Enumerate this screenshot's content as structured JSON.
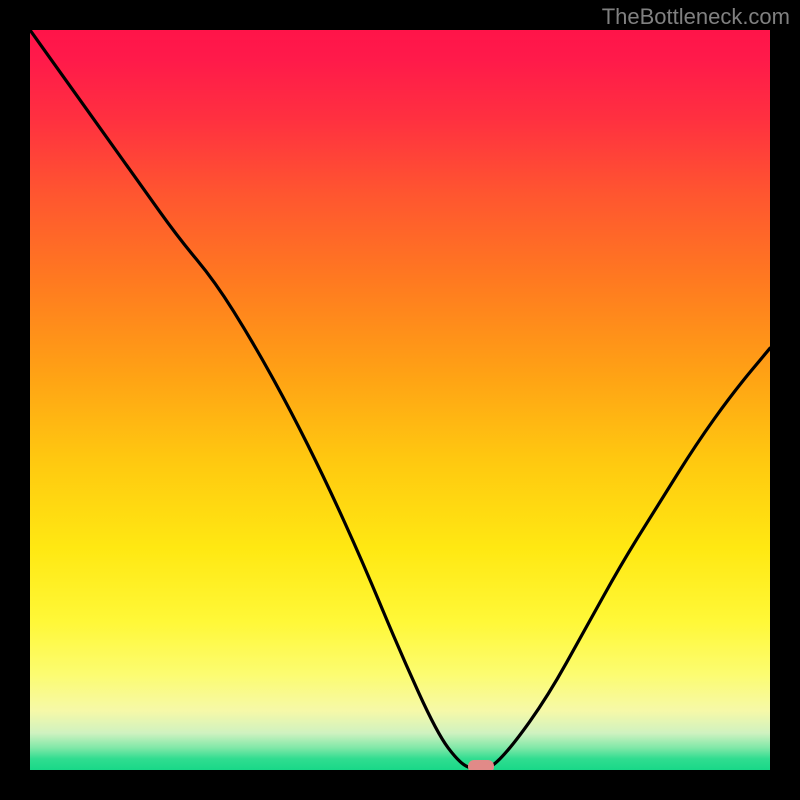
{
  "attribution": "TheBottleneck.com",
  "chart_data": {
    "type": "line",
    "title": "",
    "xlabel": "",
    "ylabel": "",
    "xlim": [
      0,
      100
    ],
    "ylim": [
      0,
      100
    ],
    "x": [
      0,
      5,
      10,
      15,
      20,
      25,
      30,
      35,
      40,
      45,
      50,
      55,
      58,
      60,
      62,
      65,
      70,
      75,
      80,
      85,
      90,
      95,
      100
    ],
    "values": [
      100,
      93,
      86,
      79,
      72,
      66,
      58,
      49,
      39,
      28,
      16,
      5,
      1,
      0,
      0,
      3,
      10,
      19,
      28,
      36,
      44,
      51,
      57
    ],
    "marker_x": 61,
    "marker_y": 0,
    "gradient_stops": [
      {
        "pos": 0,
        "color": "#ff1449"
      },
      {
        "pos": 50,
        "color": "#ffb412"
      },
      {
        "pos": 80,
        "color": "#fff838"
      },
      {
        "pos": 100,
        "color": "#18d888"
      }
    ]
  }
}
